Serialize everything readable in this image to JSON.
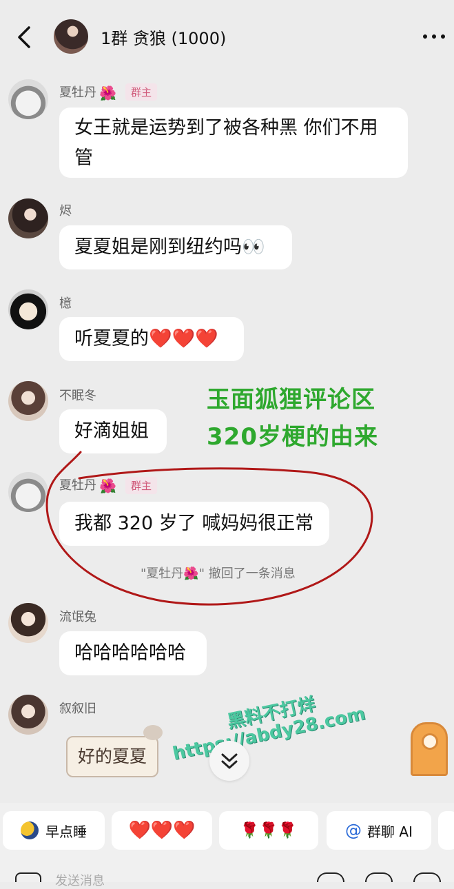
{
  "header": {
    "title": "1群 贪狼 (1000)",
    "back_icon": "chevron-left-icon",
    "more_icon": "more-dots-icon"
  },
  "messages": [
    {
      "sender": "夏牡丹",
      "flower": "🌺",
      "badge": "群主",
      "text_line1": "女王就是运势到了被各种黑 你们不用",
      "text_line2": "管"
    },
    {
      "sender": "烬",
      "text": "夏夏姐是刚到纽约吗👀"
    },
    {
      "sender": "檍",
      "text": "听夏夏的❤️❤️❤️"
    },
    {
      "sender": "不眠冬",
      "text": "好滴姐姐"
    },
    {
      "sender": "夏牡丹",
      "flower": "🌺",
      "badge": "群主",
      "text": "我都 320 岁了 喊妈妈很正常"
    },
    {
      "sender": "流氓兔",
      "text": "哈哈哈哈哈哈"
    },
    {
      "sender": "叙叙旧",
      "sticker": "好的夏夏"
    }
  ],
  "recall_notice": "\"夏牡丹🌺\" 撤回了一条消息",
  "overlay": {
    "line1": "玉面狐狸评论区",
    "line2": "320岁梗的由来"
  },
  "watermark": {
    "line1": "黑料不打烊",
    "line2": "https://abdy28.com"
  },
  "quickbar": {
    "chips": [
      {
        "label": "早点睡",
        "icon": "moon-icon"
      },
      {
        "label": "❤️❤️❤️"
      },
      {
        "label": "🌹🌹🌹"
      },
      {
        "label": "群聊 AI",
        "icon": "at-icon"
      }
    ]
  },
  "input": {
    "placeholder": "发送消息"
  },
  "colors": {
    "overlay_green": "#2ea82e",
    "annotation_red": "#b01818",
    "watermark": "#4cc8a0"
  }
}
